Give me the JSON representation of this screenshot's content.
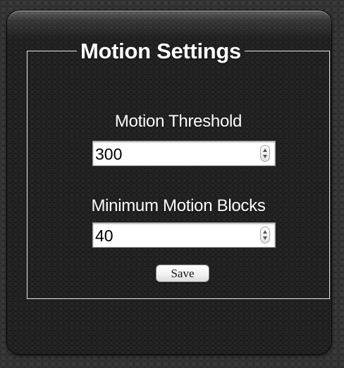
{
  "settings": {
    "legend": "Motion Settings",
    "motion_threshold": {
      "label": "Motion Threshold",
      "value": "300"
    },
    "minimum_motion_blocks": {
      "label": "Minimum Motion Blocks",
      "value": "40"
    },
    "save_label": "Save"
  },
  "icons": {
    "spinner": "up-down-stepper-icon"
  },
  "colors": {
    "panel_background": "#161616",
    "page_background": "#2b2b2b",
    "border": "#e6e6e6",
    "text": "#ffffff"
  }
}
